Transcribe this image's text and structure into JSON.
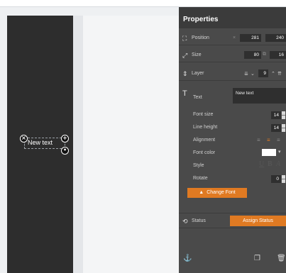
{
  "colors": {
    "panel_bg": "#4a4a4a",
    "canvas_bg": "#2d2d2d",
    "accent_orange": "#e07a22",
    "swatch": "#ffffff"
  },
  "canvas": {
    "element_text": "New text"
  },
  "properties": {
    "title": "Properties",
    "position": {
      "label": "Position",
      "x": "281",
      "y": "240"
    },
    "size": {
      "label": "Size",
      "w": "80",
      "h": "16"
    },
    "layer": {
      "label": "Layer",
      "value": "9"
    },
    "text": {
      "label": "Text",
      "value": "New text",
      "font_size": {
        "label": "Font size",
        "value": "14"
      },
      "line_height": {
        "label": "Line height",
        "value": "14"
      },
      "alignment": {
        "label": "Alignment"
      },
      "font_color": {
        "label": "Font color"
      },
      "style": {
        "label": "Style",
        "bold": "B",
        "underline": "U",
        "italic": "I",
        "extra": "A"
      },
      "rotate": {
        "label": "Rotate",
        "value": "0"
      },
      "change_font": "Change Font"
    },
    "status": {
      "label": "Status",
      "button": "Assign Status"
    }
  }
}
